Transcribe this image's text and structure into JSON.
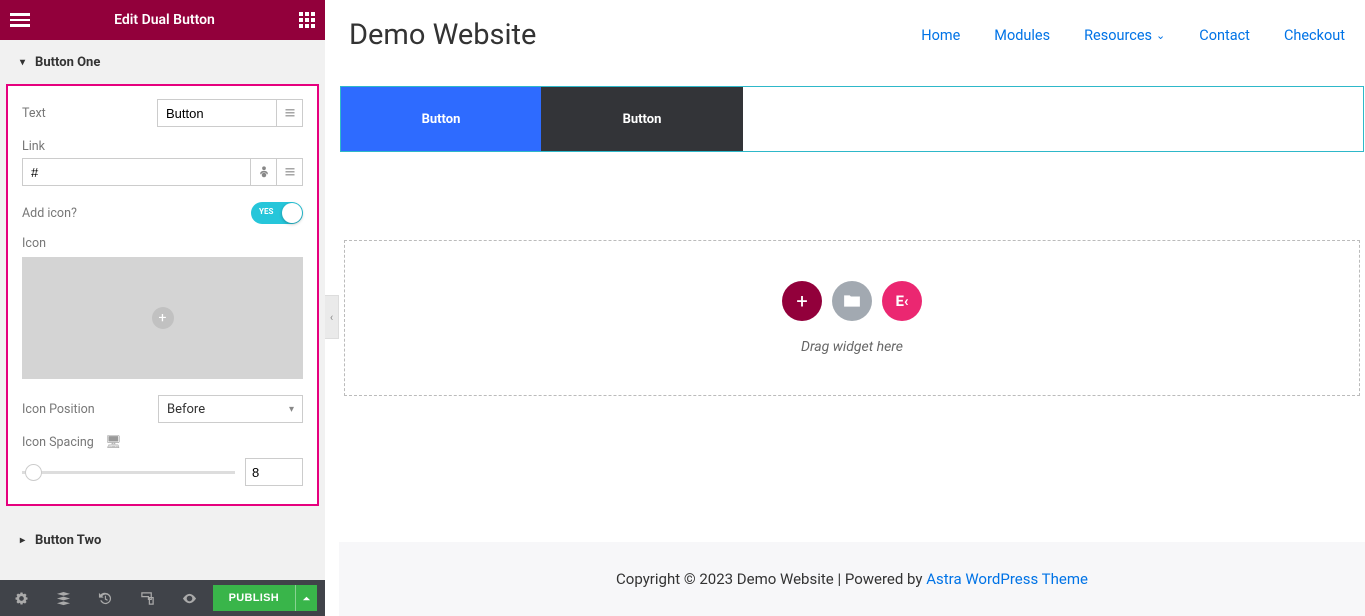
{
  "panel": {
    "title": "Edit Dual Button",
    "section_one": "Button One",
    "section_two": "Button Two",
    "text_label": "Text",
    "text_value": "Button",
    "link_label": "Link",
    "link_value": "#",
    "add_icon_label": "Add icon?",
    "add_icon_toggle": "YES",
    "icon_label": "Icon",
    "icon_pos_label": "Icon Position",
    "icon_pos_value": "Before",
    "icon_spacing_label": "Icon Spacing",
    "icon_spacing_value": "8",
    "publish": "PUBLISH"
  },
  "preview": {
    "site_title": "Demo Website",
    "nav": [
      "Home",
      "Modules",
      "Resources",
      "Contact",
      "Checkout"
    ],
    "button_a": "Button",
    "button_b": "Button",
    "ek_logo": "E‹",
    "drag_text": "Drag widget here",
    "footer_prefix": "Copyright © 2023 Demo Website | Powered by ",
    "footer_link": "Astra WordPress Theme"
  }
}
